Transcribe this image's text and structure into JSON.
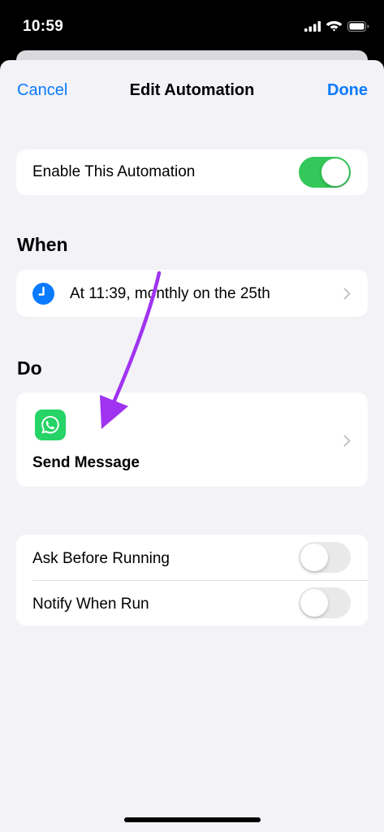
{
  "status_bar": {
    "time": "10:59",
    "icons": [
      "cellular-signal-icon",
      "wifi-icon",
      "battery-icon"
    ]
  },
  "nav": {
    "cancel_label": "Cancel",
    "title": "Edit Automation",
    "done_label": "Done"
  },
  "enable": {
    "label": "Enable This Automation",
    "on": true
  },
  "when": {
    "header": "When",
    "trigger_text": "At 11:39, monthly on the 25th",
    "icon": "clock-icon"
  },
  "do": {
    "header": "Do",
    "action_label": "Send Message",
    "app_icon": "whatsapp-icon"
  },
  "options": {
    "ask_before_running": {
      "label": "Ask Before Running",
      "on": false
    },
    "notify_when_run": {
      "label": "Notify When Run",
      "on": false
    }
  },
  "colors": {
    "accent": "#0a7aff",
    "toggle_on": "#34c759",
    "background": "#f2f2f7",
    "whatsapp": "#25d366",
    "annotation_arrow": "#a033f0"
  }
}
